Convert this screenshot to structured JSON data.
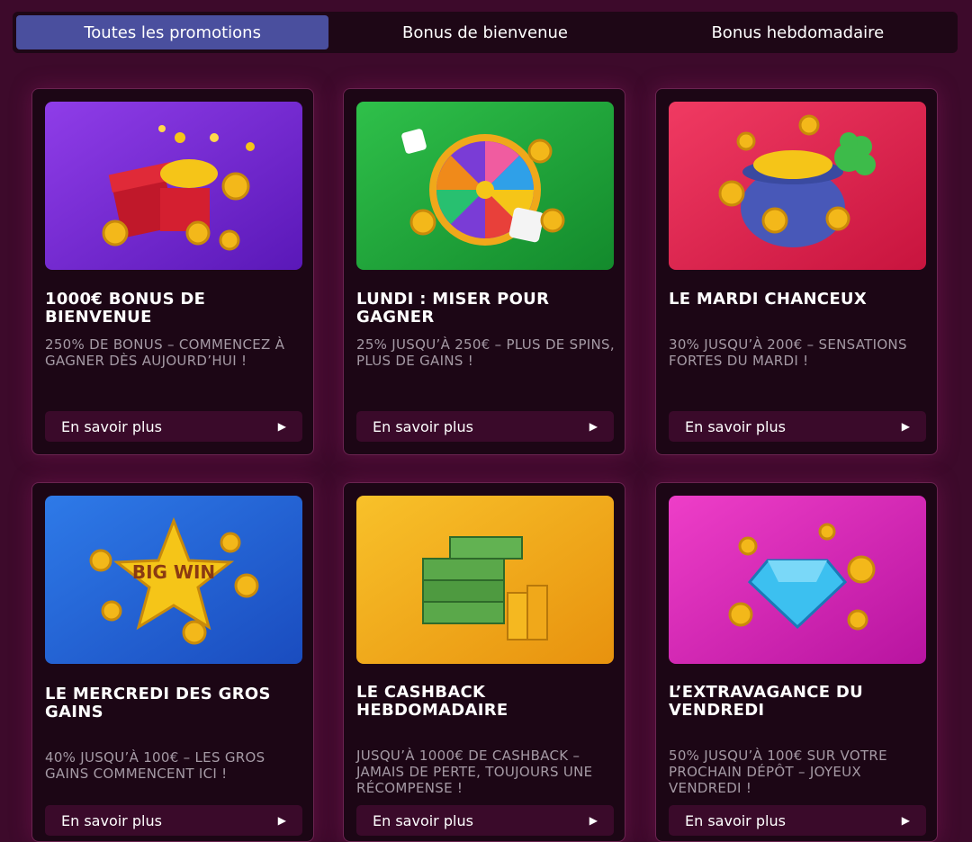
{
  "tabs": [
    {
      "label": "Toutes les promotions",
      "active": true
    },
    {
      "label": "Bonus de bienvenue",
      "active": false
    },
    {
      "label": "Bonus hebdomadaire",
      "active": false
    }
  ],
  "cards": [
    {
      "title": "1000€ BONUS DE BIENVENUE",
      "description": "250% DE BONUS – COMMENCEZ À GAGNER DÈS AUJOURD’HUI !",
      "cta": "En savoir plus",
      "art": "gift-box-coins",
      "color": "#7b2bd6"
    },
    {
      "title": "LUNDI : MISER POUR GAGNER",
      "description": "25% JUSQU’À 250€ – PLUS DE SPINS, PLUS DE GAINS !",
      "cta": "En savoir plus",
      "art": "wheel-dice",
      "color": "#1fa33a"
    },
    {
      "title": "LE MARDI CHANCEUX",
      "description": "30% JUSQU’À 200€ – SENSATIONS FORTES DU MARDI !",
      "cta": "En savoir plus",
      "art": "pot-of-gold-clover",
      "color": "#e0244f"
    },
    {
      "title": "LE MERCREDI DES GROS GAINS",
      "description": "40% JUSQU’À 100€ – LES GROS GAINS COMMENCENT ICI !",
      "cta": "En savoir plus",
      "art": "big-win-star",
      "art_text": "BIG WIN",
      "color": "#1f62d0"
    },
    {
      "title": "LE CASHBACK HEBDOMADAIRE",
      "description": "JUSQU’À 1000€ DE CASHBACK – JAMAIS DE PERTE, TOUJOURS UNE RÉCOMPENSE !",
      "cta": "En savoir plus",
      "art": "money-stacks",
      "color": "#f0a51a"
    },
    {
      "title": "L’EXTRAVAGANCE DU VENDREDI",
      "description": "50% JUSQU’À 100€ SUR VOTRE PROCHAIN DÉPÔT – JOYEUX VENDREDI !",
      "cta": "En savoir plus",
      "art": "diamond-coins",
      "color": "#d726b8"
    }
  ]
}
